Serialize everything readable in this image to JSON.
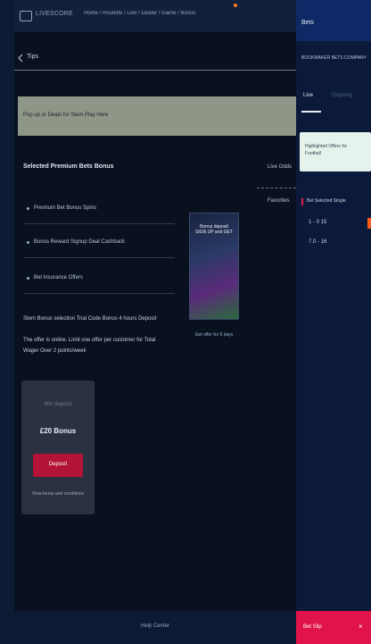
{
  "topbar": {
    "app_label": "LIVESCORE",
    "breadcrumb": "Home / Roulette / Live / Dealer / Game / Bonus"
  },
  "search": {
    "value": "Tips"
  },
  "alert": {
    "text": "Pop up or Deals for Stem Play Here"
  },
  "main": {
    "section_title": "Selected Premium Bets Bonus",
    "rows": [
      "Premium Bet Bonus Spins",
      "Bonus Reward Signup Deal Cashback",
      "Bet Insurance Offers"
    ],
    "info_line1": "Stem Bonus selection Trial Code Bonus 4 hours Deposit",
    "info_line2": "The offer is online. Limit one offer per customer for Total",
    "info_line3": "Wager Over 2 points/week"
  },
  "banner": {
    "title": "Bonus deposit SIGN UP and GET",
    "caption": "Get offer for 5 days"
  },
  "side": {
    "item1": "Live Odds",
    "item2": "Favorites"
  },
  "card": {
    "subtitle": "Min deposit",
    "value": "£20 Bonus",
    "button": "Deposit",
    "footer": "View terms and conditions"
  },
  "footer": {
    "text": "Help Center"
  },
  "right": {
    "title": "Bets",
    "subtitle": "BOOKMAKER BETS COMPANY",
    "tab1": "Live",
    "tab2": "Ongoing",
    "card_line1": "Highlighted Offers for",
    "card_line2": "Football",
    "section": "Bet Selected Single",
    "row1": "1 - 0 15",
    "row2": "7.0 - 16",
    "footer_label": "Bet Slip",
    "footer_close": "×"
  }
}
